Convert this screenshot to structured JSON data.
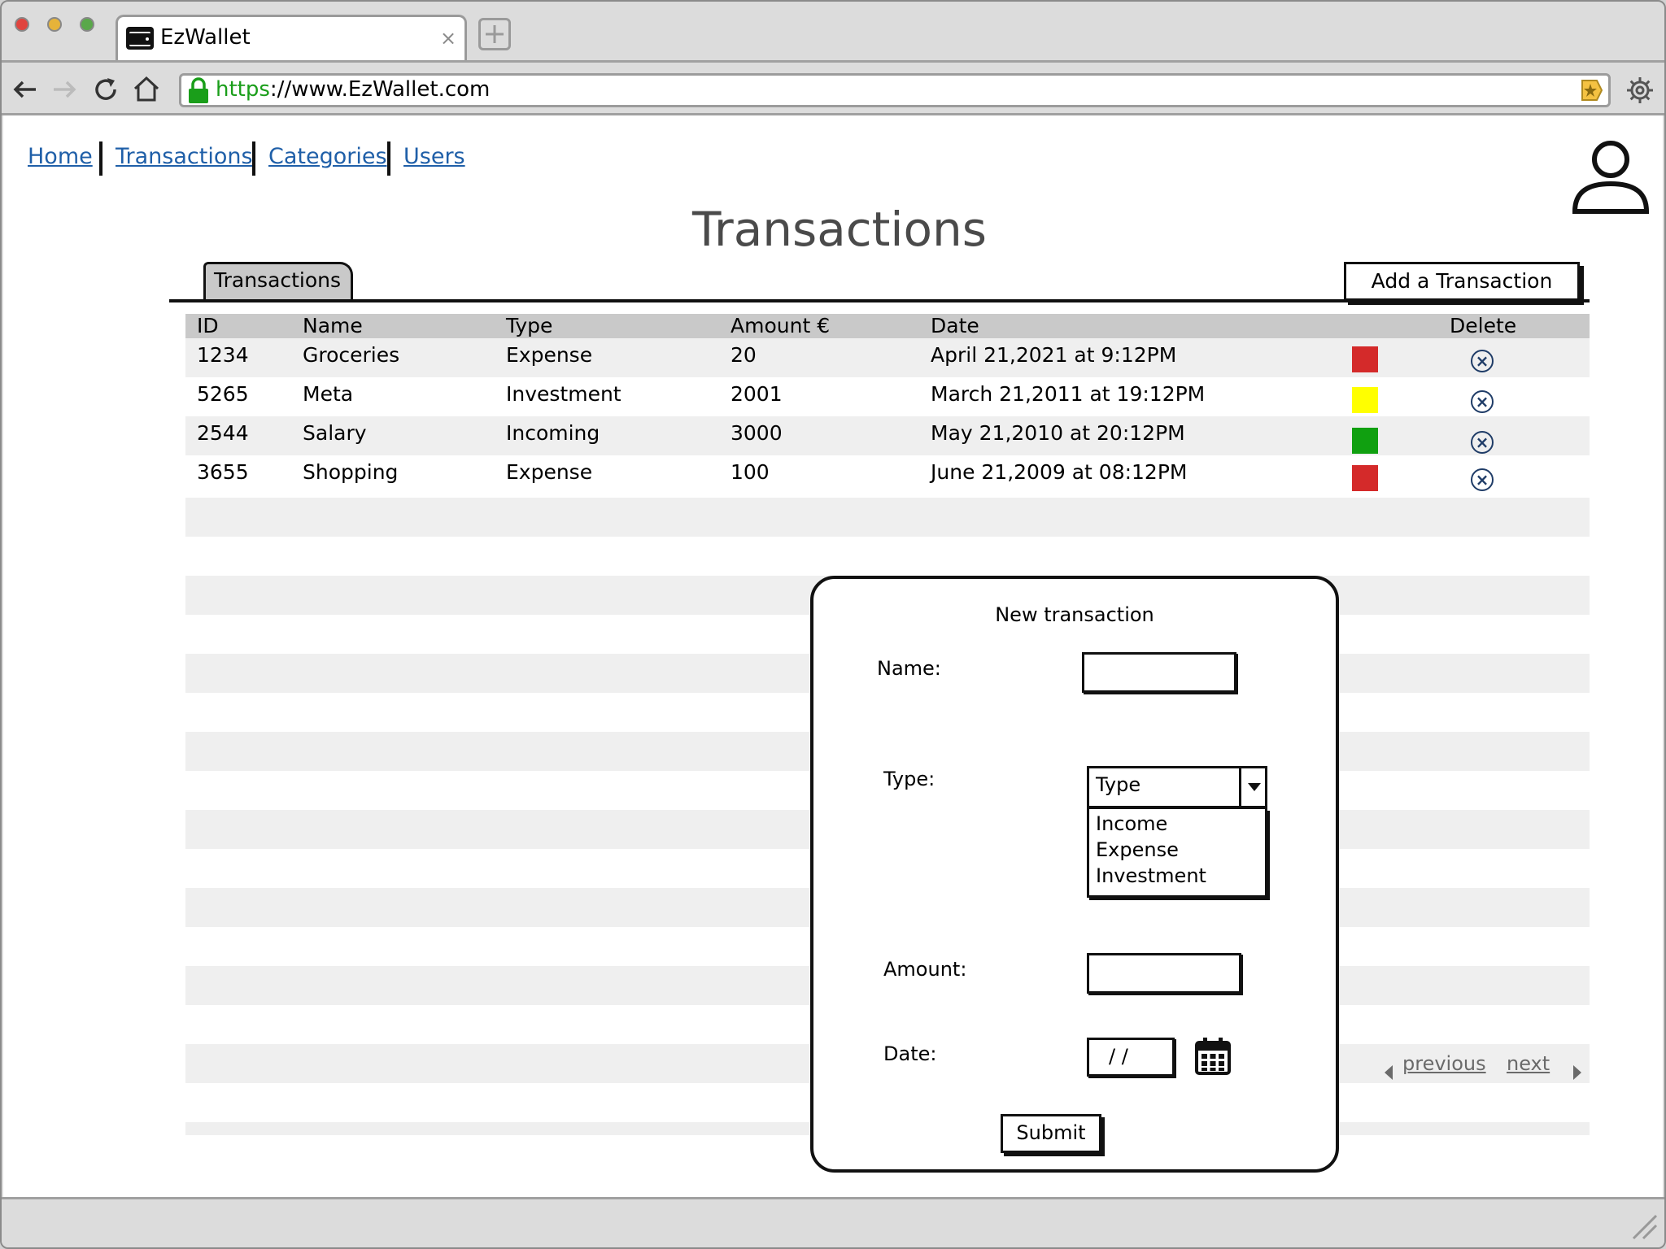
{
  "browser": {
    "tab_title": "EzWallet",
    "tab_close": "×",
    "url_scheme": "https",
    "url_rest": "://www.EzWallet.com",
    "colors": {
      "lock": "#1a9e1a",
      "scheme": "#1a9e1a",
      "bookmark": "#f5c242"
    }
  },
  "nav": {
    "links": [
      {
        "label": "Home"
      },
      {
        "label": "Transactions"
      },
      {
        "label": "Categories"
      },
      {
        "label": "Users"
      }
    ],
    "user_icon": "user-icon"
  },
  "page": {
    "title": "Transactions",
    "tab_label": "Transactions",
    "add_button": "Add a Transaction"
  },
  "table": {
    "headers": [
      "ID",
      "Name",
      "Type",
      "Amount €",
      "Date",
      "Delete"
    ],
    "rows": [
      {
        "id": "1234",
        "name": "Groceries",
        "type": "Expense",
        "amount": "20",
        "date": "April 21,2021 at 9:12PM",
        "color": "#d42a2a"
      },
      {
        "id": "5265",
        "name": "Meta",
        "type": "Investment",
        "amount": "2001",
        "date": "March 21,2011 at 19:12PM",
        "color": "#ffff00"
      },
      {
        "id": "2544",
        "name": "Salary",
        "type": "Incoming",
        "amount": "3000",
        "date": "May 21,2010 at 20:12PM",
        "color": "#10a010"
      },
      {
        "id": "3655",
        "name": "Shopping",
        "type": "Expense",
        "amount": "100",
        "date": "June 21,2009 at 08:12PM",
        "color": "#d42a2a"
      }
    ],
    "delete_glyph": "×"
  },
  "modal": {
    "title": "New transaction",
    "name_label": "Name:",
    "type_label": "Type:",
    "type_value": "Type",
    "type_options": [
      "Income",
      "Expense",
      "Investment"
    ],
    "amount_label": "Amount:",
    "date_label": "Date:",
    "date_value": "/ /",
    "submit": "Submit"
  },
  "pagination": {
    "previous": "previous",
    "next": "next"
  }
}
